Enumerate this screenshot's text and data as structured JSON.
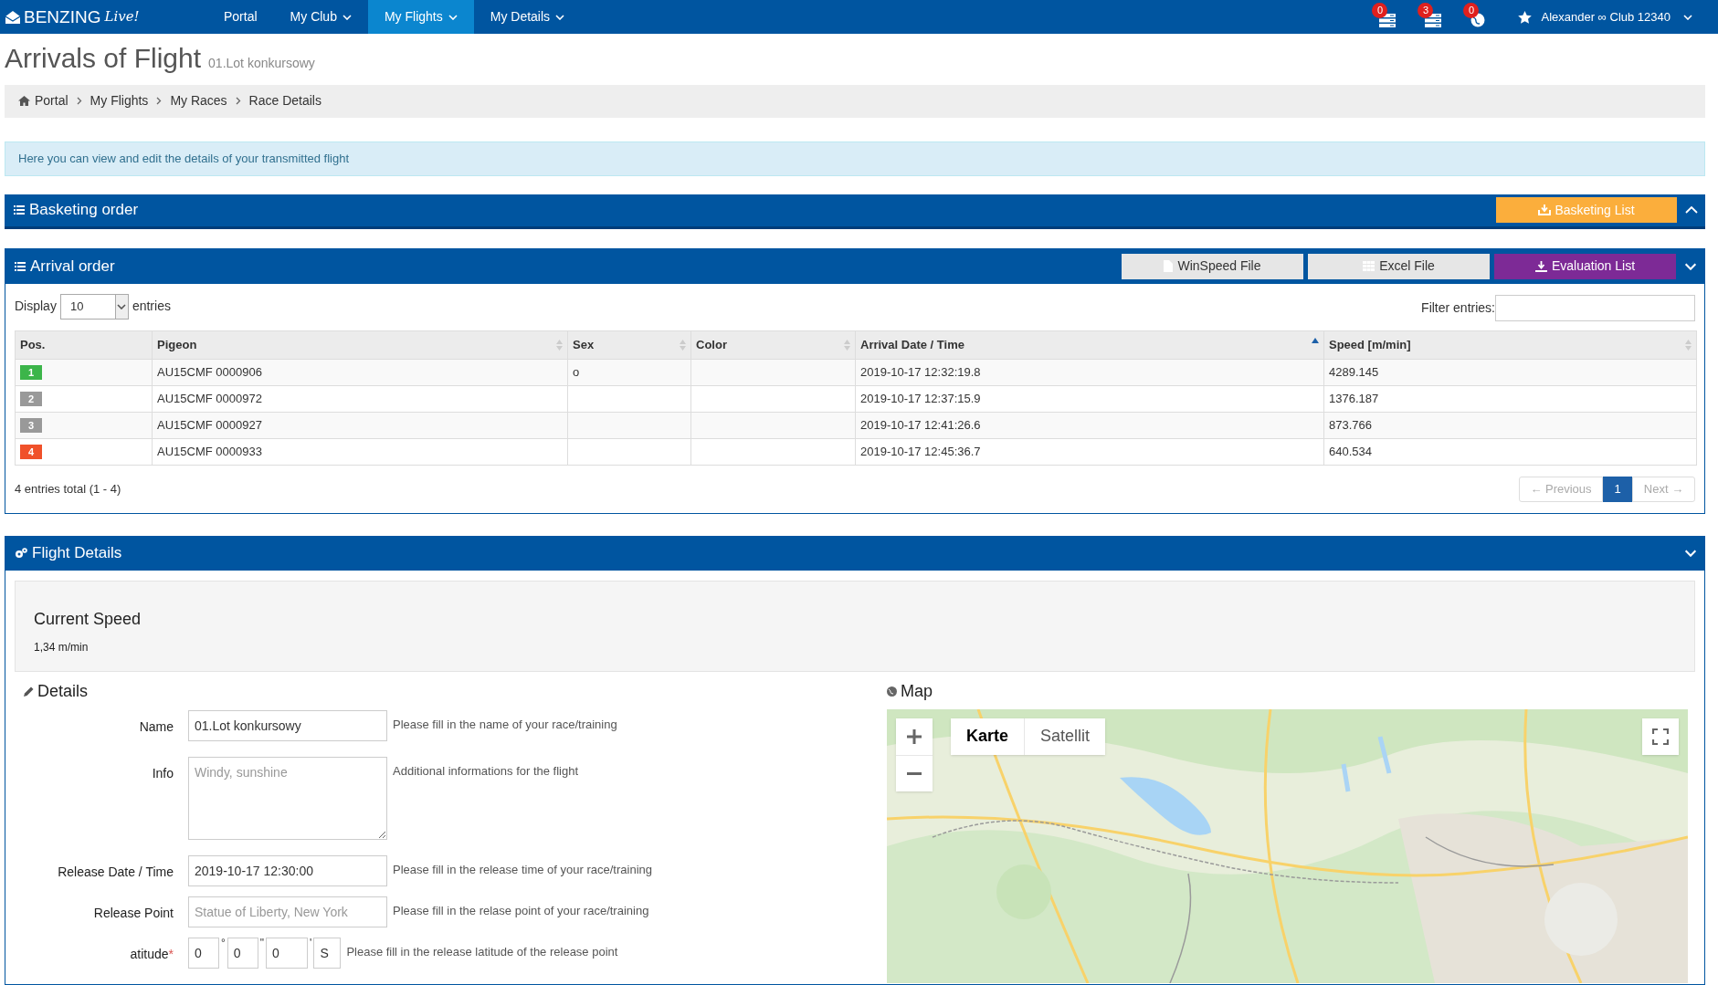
{
  "navbar": {
    "brand": "BENZING",
    "brand_script": "Live!",
    "items": [
      {
        "label": "Portal",
        "dropdown": false,
        "selected": false
      },
      {
        "label": "My Club",
        "dropdown": true,
        "selected": false
      },
      {
        "label": "My Flights",
        "dropdown": true,
        "selected": true
      },
      {
        "label": "My Details",
        "dropdown": true,
        "selected": false
      }
    ],
    "notifications": [
      {
        "kind": "tray",
        "count": "0"
      },
      {
        "kind": "tray",
        "count": "3"
      },
      {
        "kind": "globe",
        "count": "0"
      }
    ],
    "user": "Alexander ∞ Club 12340"
  },
  "page": {
    "title": "Arrivals of Flight",
    "subtitle": "01.Lot konkursowy"
  },
  "breadcrumb": [
    "Portal",
    "My Flights",
    "My Races",
    "Race Details"
  ],
  "info": "Here you can view and edit the details of your transmitted flight",
  "basketing_panel": {
    "title": "Basketing order",
    "button": "Basketing List",
    "expanded": false
  },
  "arrival_panel": {
    "title": "Arrival order",
    "buttons": [
      {
        "label": "WinSpeed File",
        "kind": "file"
      },
      {
        "label": "Excel File",
        "kind": "excel"
      },
      {
        "label": "Evaluation List",
        "kind": "evaluation"
      }
    ],
    "expanded": true,
    "display_label": "Display",
    "display_value": "10",
    "entries_label": "entries",
    "filter_label": "Filter entries:",
    "table": {
      "columns": [
        {
          "label": "Pos.",
          "sortable": false,
          "sorted": false
        },
        {
          "label": "Pigeon",
          "sortable": true,
          "sorted": false
        },
        {
          "label": "Sex",
          "sortable": true,
          "sorted": false
        },
        {
          "label": "Color",
          "sortable": true,
          "sorted": false
        },
        {
          "label": "Arrival Date / Time",
          "sortable": true,
          "sorted": true
        },
        {
          "label": "Speed [m/min]",
          "sortable": true,
          "sorted": false
        }
      ],
      "rows": [
        {
          "color": "#3cb54a",
          "cells": [
            "1",
            "AU15CMF 0000906",
            "o",
            "",
            "2019-10-17 12:32:19.8",
            "4289.145"
          ]
        },
        {
          "color": "#999999",
          "cells": [
            "2",
            "AU15CMF 0000972",
            "",
            "",
            "2019-10-17 12:37:15.9",
            "1376.187"
          ]
        },
        {
          "color": "#999999",
          "cells": [
            "3",
            "AU15CMF 0000927",
            "",
            "",
            "2019-10-17 12:41:26.6",
            "873.766"
          ]
        },
        {
          "color": "#f0512a",
          "cells": [
            "4",
            "AU15CMF 0000933",
            "",
            "",
            "2019-10-17 12:45:36.7",
            "640.534"
          ]
        }
      ]
    },
    "total": "4 entries total (1 - 4)",
    "pagination": [
      {
        "label": "← Previous",
        "kind": "prev",
        "selected": false,
        "disabled": true
      },
      {
        "label": "1",
        "kind": "page",
        "selected": true
      },
      {
        "label": "Next →",
        "kind": "next",
        "selected": false,
        "disabled": true
      }
    ]
  },
  "flight_panel": {
    "title": "Flight Details",
    "expanded": true,
    "current_speed_title": "Current Speed",
    "current_speed": "1,34 m/min",
    "details_title": "Details",
    "map_title": "Map",
    "fields": [
      {
        "label": "Name",
        "kind": "input",
        "value": "01.Lot konkursowy",
        "help": "Please fill in the name of your race/training"
      },
      {
        "label": "Info",
        "kind": "textarea",
        "placeholder": "Windy, sunshine",
        "help": "Additional informations for the flight"
      },
      {
        "label": "Release Date / Time",
        "kind": "input",
        "value": "2019-10-17 12:30:00",
        "help": "Please fill in the release time of your race/training"
      },
      {
        "label": "Release Point",
        "kind": "input",
        "placeholder": "Statue of Liberty, New York",
        "help": "Please fill in the relase point of your race/training"
      },
      {
        "label": "atitude",
        "kind": "coords",
        "required_mark": "*",
        "parts": [
          {
            "value": "0",
            "unit": "°"
          },
          {
            "value": "0",
            "unit": "\""
          },
          {
            "value": "0",
            "unit": "'"
          },
          {
            "value": "S"
          }
        ],
        "help": "Please fill in the release latitude of the release point"
      }
    ],
    "map": {
      "kind": "picture",
      "types": [
        {
          "label": "Karte",
          "selected": true
        },
        {
          "label": "Satellit",
          "selected": false
        }
      ]
    }
  }
}
